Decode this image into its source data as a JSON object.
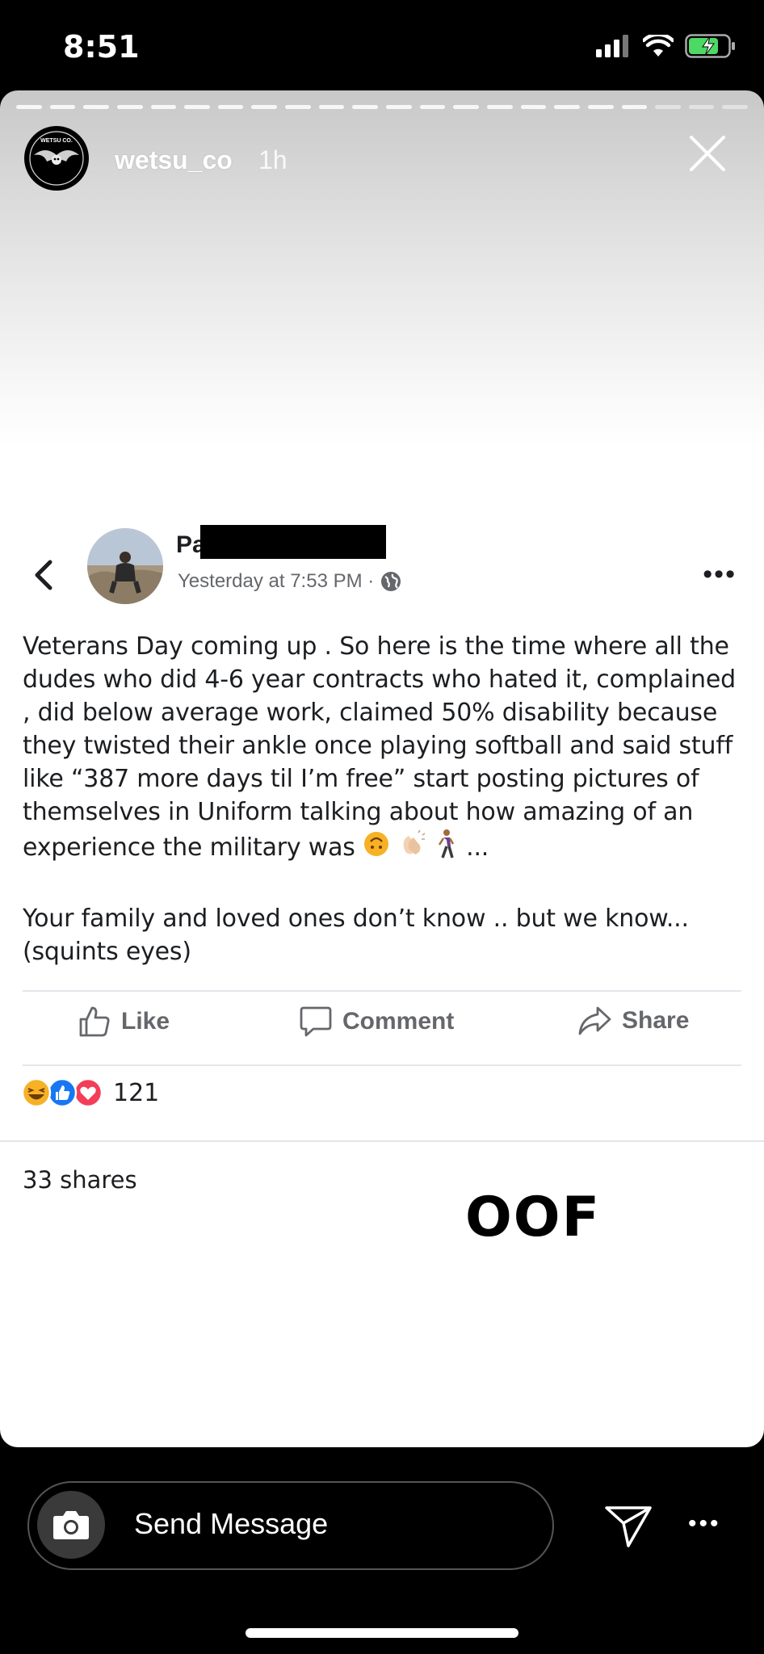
{
  "status_bar": {
    "time": "8:51"
  },
  "story": {
    "username": "wetsu_co",
    "time_ago": "1h",
    "avatar_text": "WETSU CO."
  },
  "post": {
    "author_name_visible": "Pa",
    "timestamp": "Yesterday at 7:53 PM ·",
    "paragraph1": "Veterans Day coming up . So here is the time where all the dudes who did 4-6 year contracts who hated it, complained , did below average work, claimed 50% disability because they twisted their ankle once playing softball and said stuff like “387 more days til I’m free” start posting pictures of themselves in Uniform talking about how amazing of an experience the military was",
    "paragraph1_suffix": "...",
    "paragraph2": "Your family and loved ones don’t know .. but we know... (squints eyes)",
    "actions": {
      "like": "Like",
      "comment": "Comment",
      "share": "Share"
    },
    "reaction_count": "121",
    "shares": "33 shares"
  },
  "overlay_text": "OOF",
  "message_bar": {
    "placeholder": "Send Message"
  },
  "colors": {
    "fb_text": "#1c1e21",
    "fb_meta": "#65676b",
    "like_blue": "#1877f2",
    "love_red": "#f33e58",
    "haha_yellow": "#f7b125"
  }
}
